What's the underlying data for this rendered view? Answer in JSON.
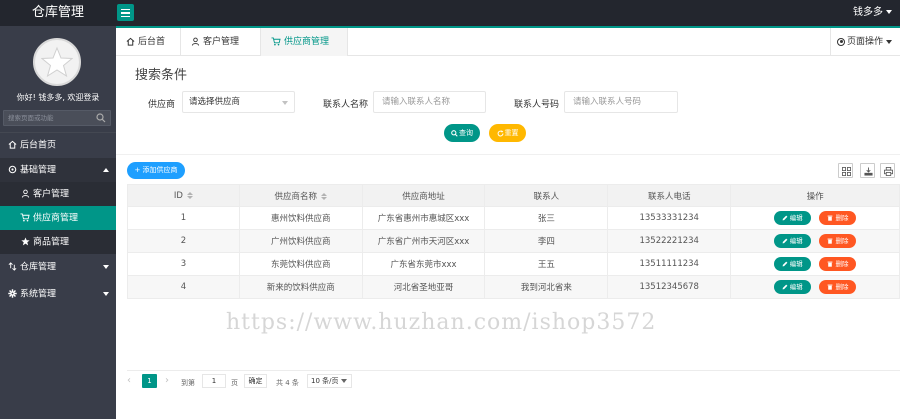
{
  "app": {
    "title": "仓库管理",
    "user_name": "钱多多"
  },
  "sidebar": {
    "greeting": "你好! 钱多多, 欢迎登录",
    "search_placeholder": "搜索页面或功能",
    "items": [
      {
        "label": "后台首页",
        "icon": "home-icon"
      },
      {
        "label": "基础管理",
        "icon": "gear-icon",
        "expanded": true
      },
      {
        "label": "客户管理",
        "icon": "user-icon"
      },
      {
        "label": "供应商管理",
        "icon": "cart-icon",
        "active": true
      },
      {
        "label": "商品管理",
        "icon": "star-icon"
      },
      {
        "label": "仓库管理",
        "icon": "shuffle-icon"
      },
      {
        "label": "系统管理",
        "icon": "gear-icon"
      }
    ]
  },
  "tabs": [
    {
      "label": "后台首页",
      "icon": "home-icon"
    },
    {
      "label": "客户管理",
      "icon": "user-icon",
      "close": "✕"
    },
    {
      "label": "供应商管理",
      "icon": "cart-icon",
      "close": "✕",
      "active": true
    }
  ],
  "page_ops": "页面操作",
  "filter": {
    "title": "搜索条件",
    "supplier_label": "供应商",
    "supplier_value": "请选择供应商",
    "contact_name_label": "联系人名称",
    "contact_name_placeholder": "请输入联系人名称",
    "contact_phone_label": "联系人号码",
    "contact_phone_placeholder": "请输入联系人号码",
    "search_btn": "查询",
    "reset_btn": "重置"
  },
  "toolbar": {
    "add_btn": "+ 添加供应商"
  },
  "table": {
    "headers": [
      "ID",
      "供应商名称",
      "供应商地址",
      "联系人",
      "联系人电话",
      "操作"
    ],
    "edit_label": "编辑",
    "delete_label": "删除",
    "rows": [
      {
        "id": "1",
        "name": "惠州饮料供应商",
        "address": "广东省惠州市惠城区xxx",
        "contact": "张三",
        "phone": "13533331234"
      },
      {
        "id": "2",
        "name": "广州饮料供应商",
        "address": "广东省广州市天河区xxx",
        "contact": "李四",
        "phone": "13522221234"
      },
      {
        "id": "3",
        "name": "东莞饮料供应商",
        "address": "广东省东莞市xxx",
        "contact": "王五",
        "phone": "13511111234"
      },
      {
        "id": "4",
        "name": "新来的饮料供应商",
        "address": "河北省圣地亚哥",
        "contact": "我到河北省来",
        "phone": "13512345678"
      }
    ]
  },
  "pager": {
    "current": "1",
    "goto_label": "到第",
    "goto_value": "1",
    "unit": "页",
    "ok": "确定",
    "total": "共 4 条",
    "page_size": "10 条/页"
  },
  "watermark": "https://www.huzhan.com/ishop3572",
  "colors": {
    "accent": "#009688",
    "topbar": "#23262e",
    "sidebar": "#393d49",
    "add": "#1e9fff",
    "warn": "#ffb800",
    "danger": "#ff5722"
  }
}
